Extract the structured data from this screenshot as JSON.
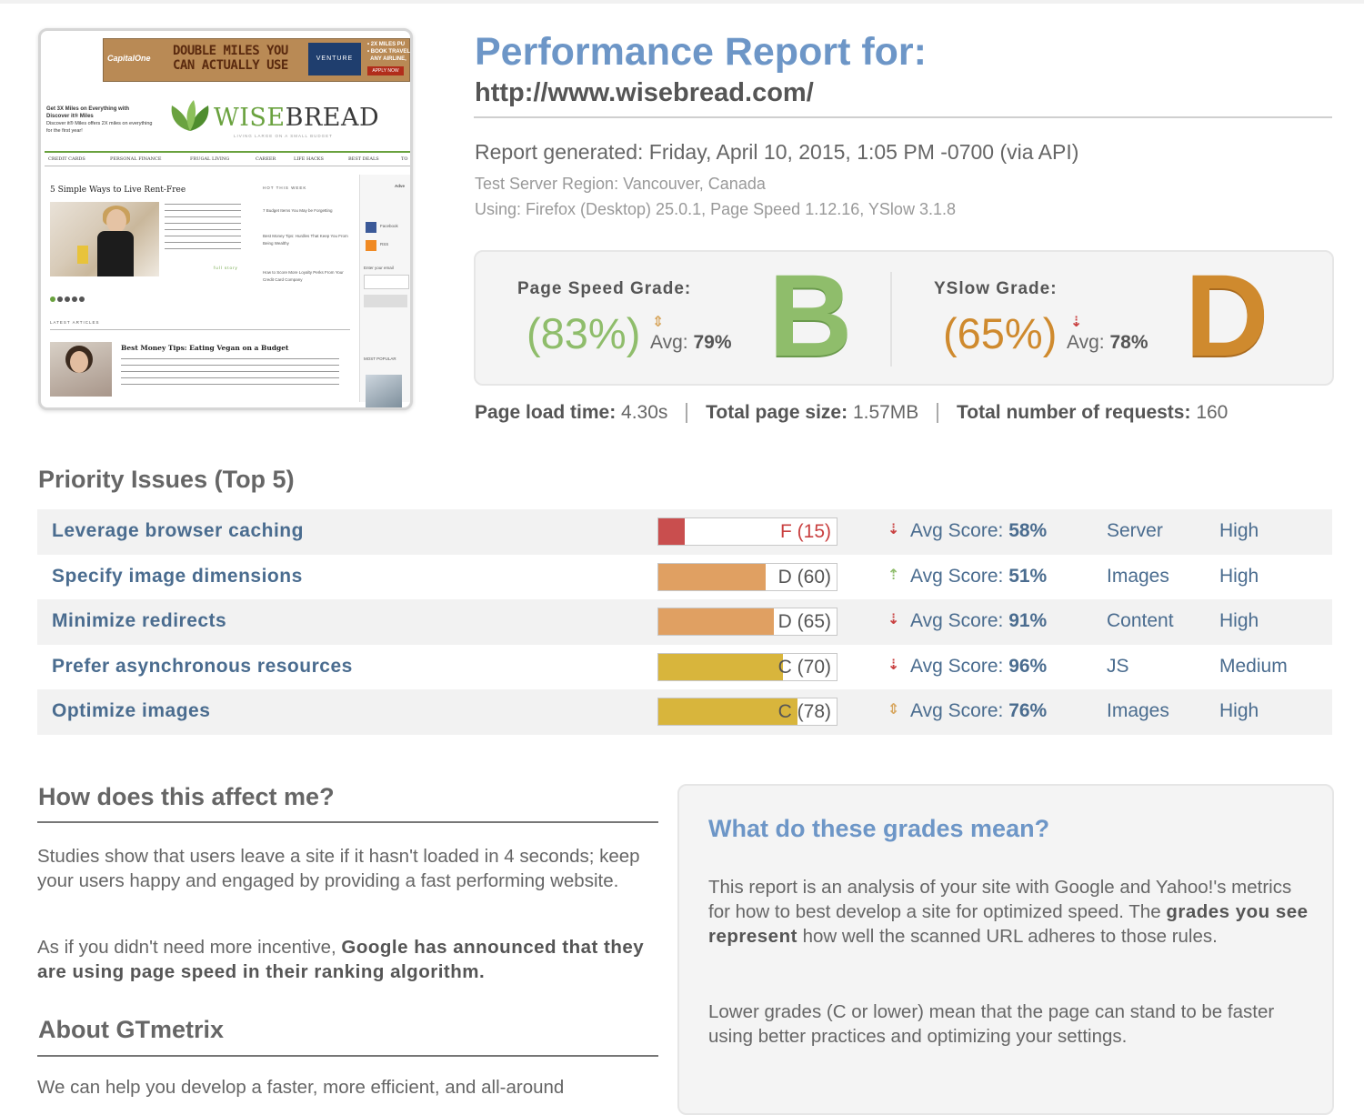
{
  "header": {
    "title": "Performance Report for:",
    "url": "http://www.wisebread.com/",
    "generated": "Report generated: Friday, April 10, 2015, 1:05 PM -0700 (via API)",
    "region": "Test Server Region: Vancouver, Canada",
    "using": "Using: Firefox (Desktop) 25.0.1, Page Speed 1.12.16, YSlow 3.1.8"
  },
  "thumbnail": {
    "ad_brand": "CapitalOne",
    "ad_text": "DOUBLE MILES YOU CAN ACTUALLY USE",
    "ad_card": "VENTURE",
    "ad_side": "• 2X MILES PU\n• BOOK TRAVEL\n  ANY AIRLINE,",
    "ad_apply": "APPLY NOW",
    "promo_title": "Get 3X Miles on Everything with Discover it® Miles",
    "promo_body": "Discover it® Miles offers 2X miles on everything for the first year!",
    "logo_w": "WISE",
    "logo_rest": "BREAD",
    "tagline": "LIVING LARGE ON A SMALL BUDGET",
    "nav": [
      "CREDIT CARDS",
      "PERSONAL FINANCE",
      "FRUGAL LIVING",
      "CAREER",
      "LIFE HACKS",
      "BEST DEALS",
      "TO"
    ],
    "article_title": "5 Simple Ways to Live Rent-Free",
    "hot_week": "HOT THIS WEEK",
    "hot_items": [
      "7 Budget Items You May be Forgetting",
      "Best Money Tips: Hurdles That Keep You From Being Wealthy",
      "How to Score More Loyalty Perks From Your Credit Card Company"
    ],
    "side_labels": [
      "Adve",
      "Facebook",
      "RSS",
      "Enter your email"
    ],
    "full_story": "full story",
    "latest": "LATEST ARTICLES",
    "most_popular": "MOST POPULAR",
    "article2_title": "Best Money Tips: Eating Vegan on a Budget"
  },
  "grades": {
    "pagespeed": {
      "label": "Page Speed Grade:",
      "pct": "(83%)",
      "avg_label": "Avg:",
      "avg_value": "79%",
      "letter": "B",
      "color": "#8fbd6b",
      "trend": "flat"
    },
    "yslow": {
      "label": "YSlow Grade:",
      "pct": "(65%)",
      "avg_label": "Avg:",
      "avg_value": "78%",
      "letter": "D",
      "color": "#cf8a2e",
      "trend": "down"
    }
  },
  "stats": [
    {
      "label": "Page load time:",
      "value": "4.30s"
    },
    {
      "label": "Total page size:",
      "value": "1.57MB"
    },
    {
      "label": "Total number of requests:",
      "value": "160"
    }
  ],
  "priority": {
    "title": "Priority Issues (Top 5)",
    "avg_label": "Avg Score:",
    "rows": [
      {
        "name": "Leverage browser caching",
        "grade": "F (15)",
        "score": 0.15,
        "fill": "#c94e4e",
        "grade_color": "#c94040",
        "trend": "down",
        "arrow_color": "#c94040",
        "avg": "58%",
        "type": "Server",
        "priority": "High"
      },
      {
        "name": "Specify image dimensions",
        "grade": "D (60)",
        "score": 0.6,
        "fill": "#e0a062",
        "grade_color": "#555555",
        "trend": "up",
        "arrow_color": "#8fbd6b",
        "avg": "51%",
        "type": "Images",
        "priority": "High"
      },
      {
        "name": "Minimize redirects",
        "grade": "D (65)",
        "score": 0.65,
        "fill": "#e0a062",
        "grade_color": "#555555",
        "trend": "down",
        "arrow_color": "#c94040",
        "avg": "91%",
        "type": "Content",
        "priority": "High"
      },
      {
        "name": "Prefer asynchronous resources",
        "grade": "C (70)",
        "score": 0.7,
        "fill": "#d8b53c",
        "grade_color": "#555555",
        "trend": "down",
        "arrow_color": "#c94040",
        "avg": "96%",
        "type": "JS",
        "priority": "Medium"
      },
      {
        "name": "Optimize images",
        "grade": "C (78)",
        "score": 0.78,
        "fill": "#d8b53c",
        "grade_color": "#555555",
        "trend": "flat",
        "arrow_color": "#d8a862",
        "avg": "76%",
        "type": "Images",
        "priority": "High"
      }
    ]
  },
  "affect": {
    "title": "How does this affect me?",
    "p1": "Studies show that users leave a site if it hasn't loaded in 4 seconds; keep your users happy and engaged by providing a fast performing website.",
    "p2_start": "As if you didn't need more incentive, ",
    "p2_bold": "Google has announced that they are using page speed in their ranking algorithm."
  },
  "about": {
    "title": "About GTmetrix",
    "p1": "We can help you develop a faster, more efficient, and all-around"
  },
  "meaning": {
    "title": "What do these grades mean?",
    "p1_start": "This report is an analysis of your site with Google and Yahoo!'s metrics for how to best develop a site for optimized speed. The ",
    "p1_bold": "grades you see represent",
    "p1_end": " how well the scanned URL adheres to those rules.",
    "p2": "Lower grades (C or lower) mean that the page can stand to be faster using better practices and optimizing your settings."
  }
}
